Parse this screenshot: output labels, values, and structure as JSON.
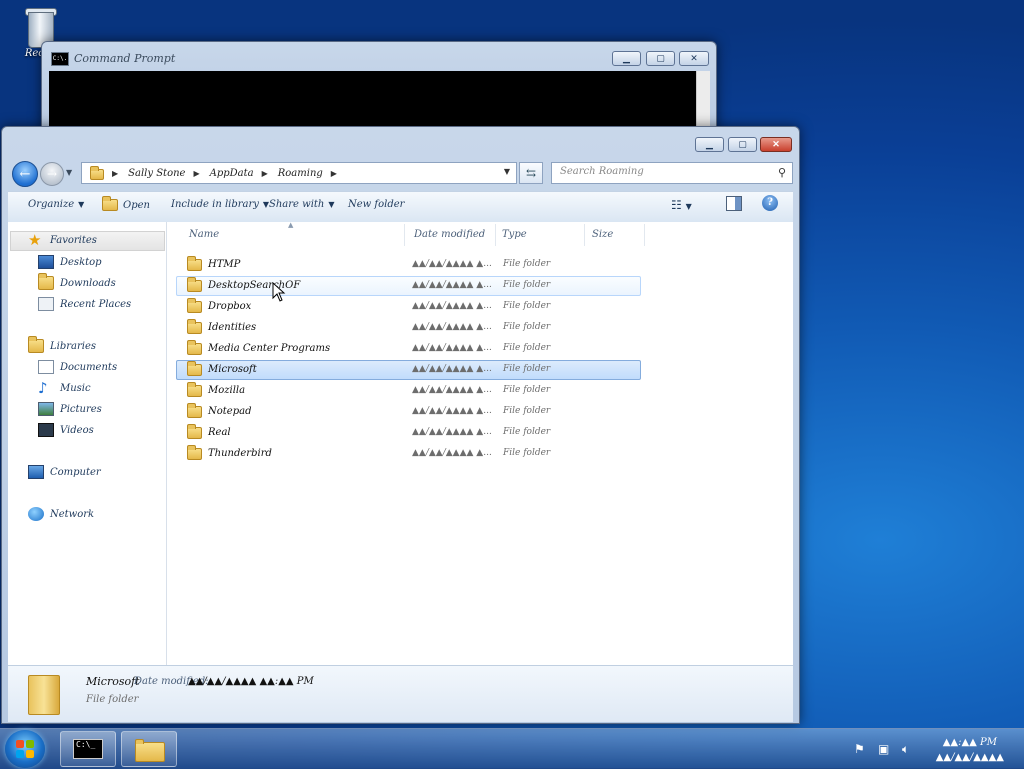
{
  "desktop": {
    "recycle_bin_label": "Recyc"
  },
  "cmd_window": {
    "title": "Command Prompt",
    "icon_text": "C:\\."
  },
  "explorer": {
    "breadcrumb": [
      "Sally Stone",
      "AppData",
      "Roaming"
    ],
    "search_placeholder": "Search Roaming",
    "toolbar": {
      "organize": "Organize",
      "open": "Open",
      "include_in_library": "Include in library",
      "share_with": "Share with",
      "new_folder": "New folder"
    },
    "nav": {
      "favorites": "Favorites",
      "desktop": "Desktop",
      "downloads": "Downloads",
      "recent_places": "Recent Places",
      "libraries": "Libraries",
      "documents": "Documents",
      "music": "Music",
      "pictures": "Pictures",
      "videos": "Videos",
      "computer": "Computer",
      "network": "Network"
    },
    "columns": {
      "name": "Name",
      "date_modified": "Date modified",
      "type": "Type",
      "size": "Size"
    },
    "files": [
      {
        "name": "HTMP",
        "date": "▲▲/▲▲/▲▲▲▲ ▲...",
        "type": "File folder"
      },
      {
        "name": "DesktopSearchOF",
        "date": "▲▲/▲▲/▲▲▲▲ ▲...",
        "type": "File folder"
      },
      {
        "name": "Dropbox",
        "date": "▲▲/▲▲/▲▲▲▲ ▲...",
        "type": "File folder"
      },
      {
        "name": "Identities",
        "date": "▲▲/▲▲/▲▲▲▲ ▲...",
        "type": "File folder"
      },
      {
        "name": "Media Center Programs",
        "date": "▲▲/▲▲/▲▲▲▲ ▲...",
        "type": "File folder"
      },
      {
        "name": "Microsoft",
        "date": "▲▲/▲▲/▲▲▲▲ ▲...",
        "type": "File folder"
      },
      {
        "name": "Mozilla",
        "date": "▲▲/▲▲/▲▲▲▲ ▲...",
        "type": "File folder"
      },
      {
        "name": "Notepad",
        "date": "▲▲/▲▲/▲▲▲▲ ▲...",
        "type": "File folder"
      },
      {
        "name": "Real",
        "date": "▲▲/▲▲/▲▲▲▲ ▲...",
        "type": "File folder"
      },
      {
        "name": "Thunderbird",
        "date": "▲▲/▲▲/▲▲▲▲ ▲...",
        "type": "File folder"
      }
    ],
    "details": {
      "name": "Microsoft",
      "modified_label": "Date modified:",
      "modified_value": "▲▲/▲▲/▲▲▲▲ ▲▲:▲▲ PM",
      "type": "File folder"
    }
  },
  "taskbar": {
    "clock_time": "▲▲:▲▲ PM",
    "clock_date": "▲▲/▲▲/▲▲▲▲"
  }
}
